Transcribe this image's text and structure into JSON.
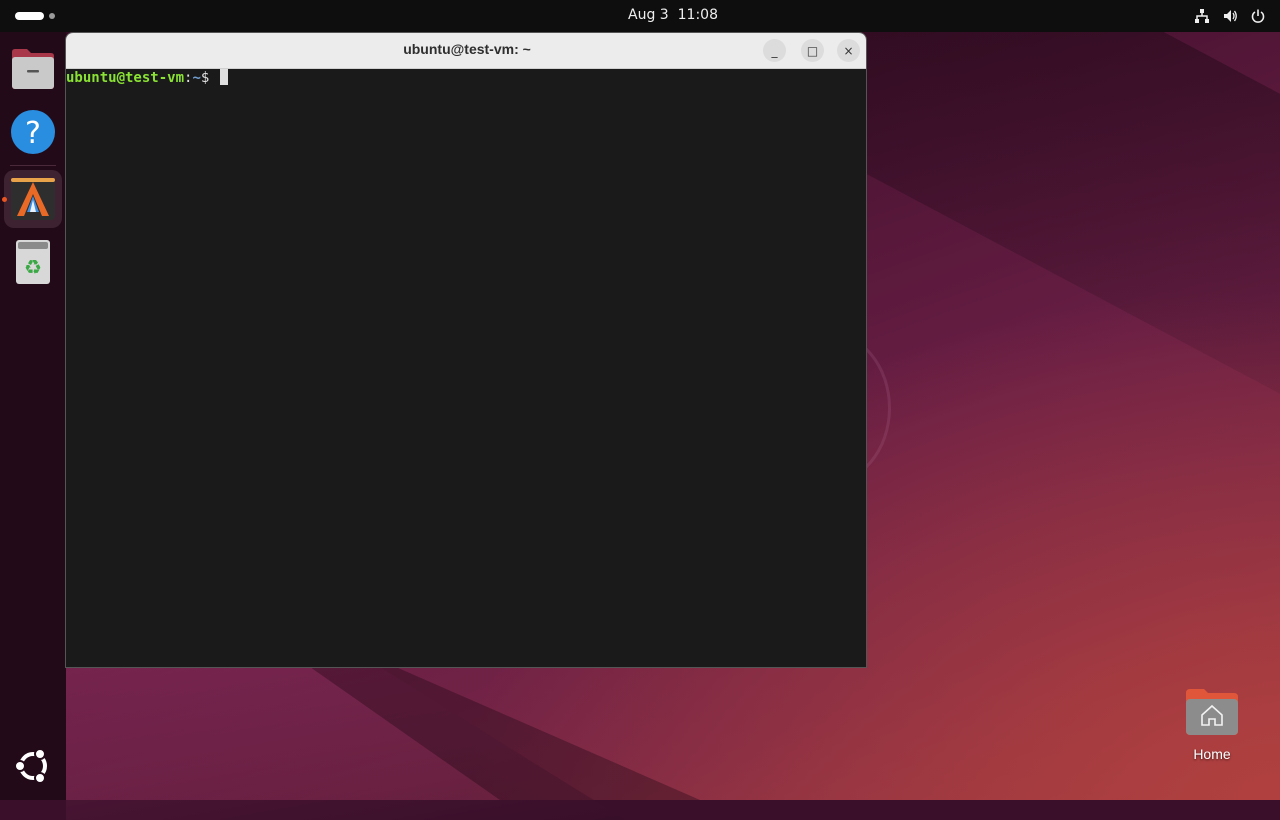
{
  "topbar": {
    "date": "Aug 3",
    "time": "11:08",
    "tray_icons": [
      "network-icon",
      "volume-icon",
      "power-icon"
    ]
  },
  "dock": {
    "items": [
      {
        "name": "files",
        "icon": "files-icon"
      },
      {
        "name": "help",
        "icon": "help-icon"
      },
      {
        "name": "alacritty",
        "icon": "alacritty-icon",
        "running": true
      },
      {
        "name": "trash",
        "icon": "trash-icon"
      }
    ],
    "app_grid_icon": "ubuntu-logo-icon"
  },
  "terminal": {
    "title": "ubuntu@test-vm: ~",
    "prompt_user": "ubuntu@test-vm",
    "prompt_sep": ":",
    "prompt_path": "~",
    "prompt_symbol": "$ ",
    "buttons": {
      "minimize": "_",
      "maximize": "□",
      "close": "×"
    },
    "colors": {
      "user": "#8ae234",
      "path": "#729fcf",
      "background": "#1a1a1a"
    }
  },
  "desktop": {
    "home_label": "Home"
  },
  "colors": {
    "accent": "#e95420",
    "topbar": "#0e0e0e",
    "dock": "#230a18"
  }
}
